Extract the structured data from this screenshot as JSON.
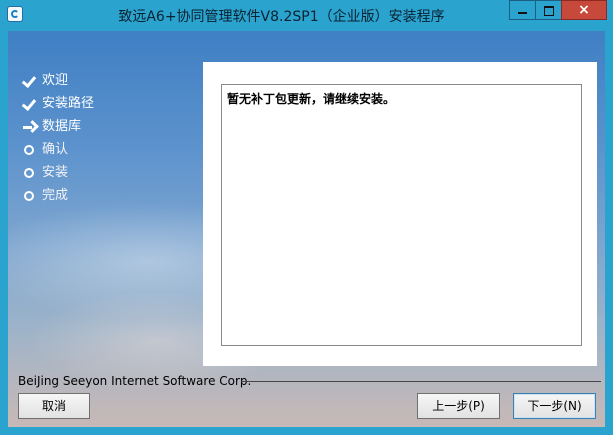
{
  "window": {
    "title": "致远A6+协同管理软件V8.2SP1（企业版）安装程序",
    "close_glyph": "×"
  },
  "steps": [
    {
      "label": "欢迎",
      "state": "done",
      "icon": "check-icon"
    },
    {
      "label": "安装路径",
      "state": "done",
      "icon": "check-icon"
    },
    {
      "label": "数据库",
      "state": "current",
      "icon": "arrow-right-icon"
    },
    {
      "label": "确认",
      "state": "pending",
      "icon": "circle-icon"
    },
    {
      "label": "安装",
      "state": "pending",
      "icon": "circle-icon"
    },
    {
      "label": "完成",
      "state": "pending",
      "icon": "circle-icon"
    }
  ],
  "panel": {
    "message": "暂无补丁包更新，请继续安装。"
  },
  "footer": {
    "company": "BeiJing Seeyon Internet Software Corp.",
    "cancel_label": "取消",
    "prev_label": "上一步(P)",
    "next_label": "下一步(N)"
  },
  "colors": {
    "titlebar": "#2aa3cf",
    "close_button": "#c7493b",
    "background_sky": "#5d93cd"
  }
}
